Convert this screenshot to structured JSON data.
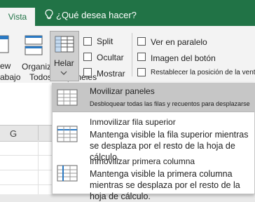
{
  "ribbon": {
    "tab_vista": "Vista",
    "tell_me": "¿Qué desea hacer?",
    "left_labels": {
      "view_partial": "ew",
      "layout_partial": "abajo"
    },
    "organize_label": "Organizar",
    "freeze_label": "Helar",
    "group_label": "Todos los paneles",
    "split_label": "Split",
    "hide_label": "Ocultar",
    "show_label": "Mostrar",
    "side_by_side_label": "Ver en paralelo",
    "sync_scroll_label": "Imagen del botón",
    "reset_position_label": "Restablecer la posición de la ventana"
  },
  "sheet": {
    "column_header": "G"
  },
  "dropdown": {
    "items": [
      {
        "title": "Movilizar paneles",
        "description": "Desbloquear todas las filas y recuentos para desplazarse",
        "highlighted": true
      },
      {
        "title": "Inmovilizar fila superior",
        "description": "Mantenga visible la fila superior mientras se desplaza por el resto de la hoja de cálculo."
      },
      {
        "title": "Inmovilizar primera columna",
        "description": "Mantenga visible la primera columna mientras se desplaza por el resto de la hoja de cálculo."
      }
    ]
  },
  "colors": {
    "ribbon_green": "#217346",
    "highlight": "#c6c6c6",
    "ribbon_bg": "#f3f3f3"
  }
}
